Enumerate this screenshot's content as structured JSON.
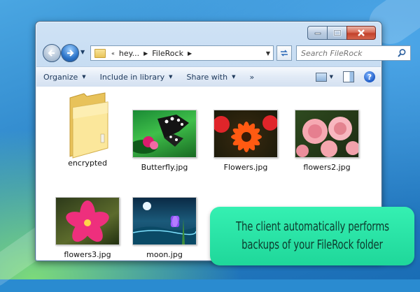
{
  "window": {
    "address_segments": [
      "hey...",
      "FileRock"
    ],
    "search_placeholder": "Search FileRock"
  },
  "command_bar": {
    "organize": "Organize",
    "include_in_library": "Include in library",
    "share_with": "Share with",
    "more": "»"
  },
  "files": [
    {
      "name": "encrypted",
      "type": "folder"
    },
    {
      "name": "Butterfly.jpg",
      "type": "image"
    },
    {
      "name": "Flowers.jpg",
      "type": "image"
    },
    {
      "name": "flowers2.jpg",
      "type": "image"
    },
    {
      "name": "flowers3.jpg",
      "type": "image"
    },
    {
      "name": "moon.jpg",
      "type": "image"
    }
  ],
  "callout": {
    "line1": "The client automatically performs",
    "line2": "backups of your FileRock folder"
  },
  "colors": {
    "callout_bg": "#2ae6a8",
    "window_frame": "#b5d0ec",
    "desktop": "#2b83c8"
  }
}
